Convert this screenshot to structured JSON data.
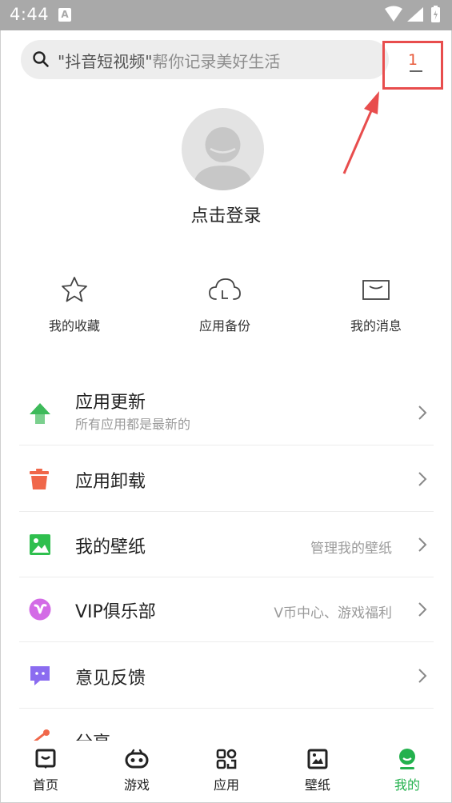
{
  "status_bar": {
    "time": "4:44",
    "notification_icon": "A"
  },
  "search": {
    "placeholder_highlight": "\"抖音短视频\"",
    "placeholder_rest": "帮你记录美好生活"
  },
  "message_badge": {
    "count": "1"
  },
  "profile": {
    "login_label": "点击登录"
  },
  "quick_actions": [
    {
      "label": "我的收藏",
      "icon": "star-icon"
    },
    {
      "label": "应用备份",
      "icon": "cloud-backup-icon"
    },
    {
      "label": "我的消息",
      "icon": "envelope-icon"
    }
  ],
  "menu": {
    "items": [
      {
        "title": "应用更新",
        "subtitle": "所有应用都是最新的",
        "right": "",
        "icon": "arrow-up-icon",
        "color": "#3dba5a"
      },
      {
        "title": "应用卸载",
        "subtitle": "",
        "right": "",
        "icon": "trash-icon",
        "color": "#f0674a"
      },
      {
        "title": "我的壁纸",
        "subtitle": "",
        "right": "管理我的壁纸",
        "icon": "image-icon",
        "color": "#2fbf4e"
      },
      {
        "title": "VIP俱乐部",
        "subtitle": "",
        "right": "V币中心、游戏福利",
        "icon": "vip-icon",
        "color": "#d36be6"
      },
      {
        "title": "意见反馈",
        "subtitle": "",
        "right": "",
        "icon": "feedback-icon",
        "color": "#8b6cf0"
      },
      {
        "title": "分享",
        "subtitle": "",
        "right": "",
        "icon": "share-icon",
        "color": "#f0674a"
      }
    ]
  },
  "tab_bar": {
    "tabs": [
      {
        "label": "首页",
        "icon": "home-icon",
        "active": false
      },
      {
        "label": "游戏",
        "icon": "gamepad-icon",
        "active": false
      },
      {
        "label": "应用",
        "icon": "apps-icon",
        "active": false
      },
      {
        "label": "壁纸",
        "icon": "wallpaper-icon",
        "active": false
      },
      {
        "label": "我的",
        "icon": "profile-icon",
        "active": true
      }
    ]
  },
  "colors": {
    "accent_active": "#23b14d",
    "annotation_red": "#e84d4d"
  }
}
